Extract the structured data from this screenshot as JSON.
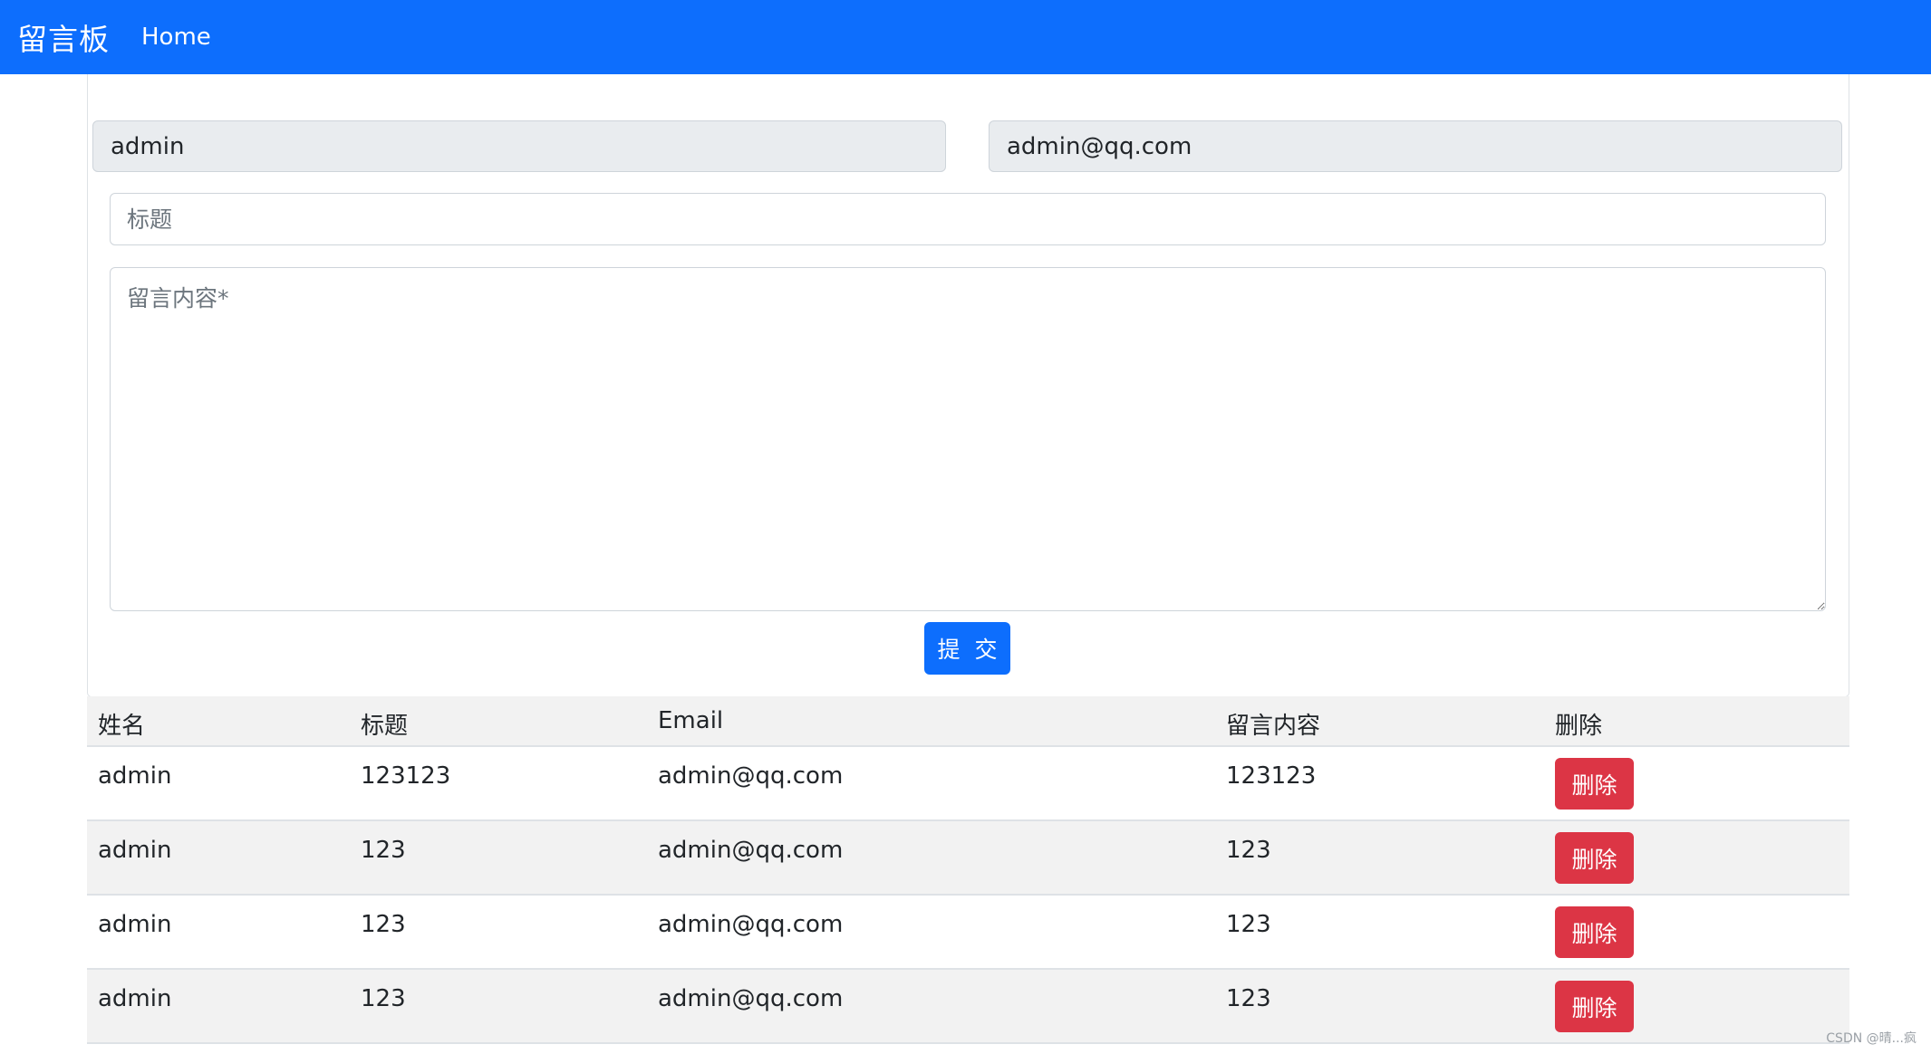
{
  "navbar": {
    "brand": "留言板",
    "home": "Home"
  },
  "form": {
    "name_value": "admin",
    "email_value": "admin@qq.com",
    "title_placeholder": "标题",
    "content_placeholder": "留言内容*",
    "submit_label": "提 交"
  },
  "table": {
    "headers": [
      "姓名",
      "标题",
      "Email",
      "留言内容",
      "删除"
    ],
    "rows": [
      {
        "name": "admin",
        "title": "123123",
        "email": "admin@qq.com",
        "content": "123123",
        "delete": "删除"
      },
      {
        "name": "admin",
        "title": "123",
        "email": "admin@qq.com",
        "content": "123",
        "delete": "删除"
      },
      {
        "name": "admin",
        "title": "123",
        "email": "admin@qq.com",
        "content": "123",
        "delete": "删除"
      },
      {
        "name": "admin",
        "title": "123",
        "email": "admin@qq.com",
        "content": "123",
        "delete": "删除"
      }
    ]
  },
  "watermark": "CSDN @晴...疯",
  "colors": {
    "primary": "#0d6efd",
    "danger": "#dc3545",
    "readonly_bg": "#e9ecef",
    "stripe": "#f2f2f2"
  }
}
